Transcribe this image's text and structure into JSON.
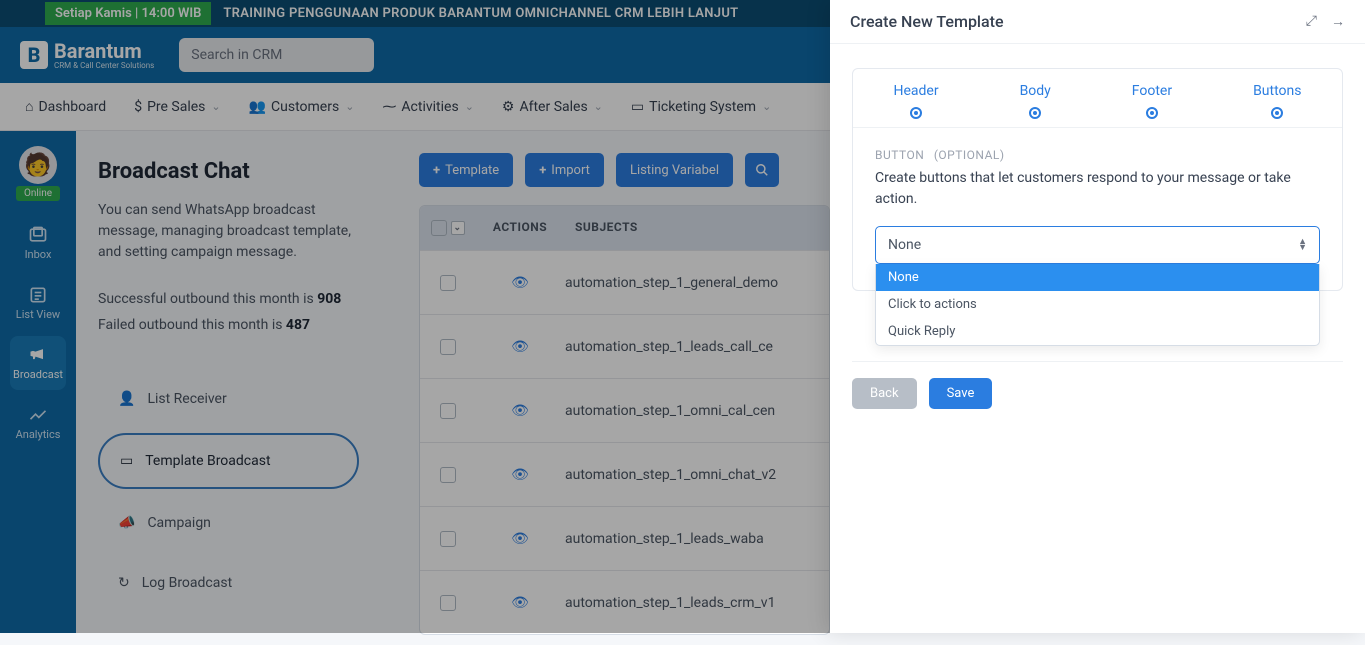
{
  "banner": {
    "badge": "Setiap Kamis | 14:00 WIB",
    "text": "TRAINING PENGGUNAAN PRODUK BARANTUM OMNICHANNEL CRM LEBIH LANJUT"
  },
  "header": {
    "brand": "Barantum",
    "brand_sub": "CRM & Call Center Solutions",
    "search_placeholder": "Search in CRM"
  },
  "main_nav": [
    {
      "icon": "⌂",
      "label": "Dashboard",
      "dd": false
    },
    {
      "icon": "$",
      "label": "Pre Sales",
      "dd": true
    },
    {
      "icon": "ᯤ",
      "label": "Customers",
      "dd": true
    },
    {
      "icon": "₪",
      "label": "Activities",
      "dd": true
    },
    {
      "icon": "⚙",
      "label": "After Sales",
      "dd": true
    },
    {
      "icon": "▭",
      "label": "Ticketing System",
      "dd": true
    }
  ],
  "sidebar": {
    "online": "Online",
    "items": [
      {
        "icon": "inbox",
        "label": "Inbox"
      },
      {
        "icon": "list",
        "label": "List View"
      },
      {
        "icon": "megaphone",
        "label": "Broadcast"
      },
      {
        "icon": "analytics",
        "label": "Analytics"
      }
    ],
    "active_index": 2
  },
  "content_left": {
    "title": "Broadcast Chat",
    "description": "You can send WhatsApp broadcast message, managing broadcast template, and setting campaign message.",
    "success_label": "Successful outbound this month is ",
    "success_count": "908",
    "failed_label": "Failed outbound this month is ",
    "failed_count": "487",
    "menu": [
      {
        "icon": "users",
        "label": "List Receiver"
      },
      {
        "icon": "card",
        "label": "Template Broadcast"
      },
      {
        "icon": "horn",
        "label": "Campaign"
      },
      {
        "icon": "clock",
        "label": "Log Broadcast"
      }
    ],
    "menu_active_index": 1
  },
  "toolbar": {
    "template": "Template",
    "import": "Import",
    "listing": "Listing Variabel"
  },
  "table": {
    "columns": {
      "actions": "ACTIONS",
      "subjects": "SUBJECTS"
    },
    "rows": [
      {
        "subject": "automation_step_1_general_demo"
      },
      {
        "subject": "automation_step_1_leads_call_ce"
      },
      {
        "subject": "automation_step_1_omni_cal_cen"
      },
      {
        "subject": "automation_step_1_omni_chat_v2"
      },
      {
        "subject": "automation_step_1_leads_waba"
      },
      {
        "subject": "automation_step_1_leads_crm_v1"
      }
    ]
  },
  "drawer": {
    "title": "Create New Template",
    "steps": [
      "Header",
      "Body",
      "Footer",
      "Buttons"
    ],
    "section_label": "BUTTON",
    "section_optional": "(OPTIONAL)",
    "section_desc": "Create buttons that let customers respond to your message or take action.",
    "select_value": "None",
    "options": [
      "None",
      "Click to actions",
      "Quick Reply"
    ],
    "back": "Back",
    "save": "Save"
  }
}
